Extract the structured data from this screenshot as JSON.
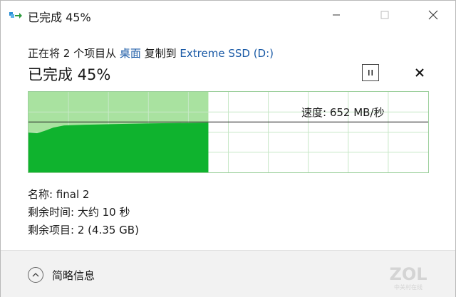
{
  "window": {
    "title": "已完成 45%"
  },
  "header": {
    "subtitle_prefix": "正在将 2 个项目从 ",
    "source": "桌面",
    "subtitle_middle": " 复制到 ",
    "destination": "Extreme SSD (D:)",
    "status": "已完成 45%"
  },
  "progress": {
    "percent": 45,
    "speed_label": "速度: 652 MB/秒"
  },
  "details": {
    "name_label": "名称:",
    "name_value": "final 2",
    "time_label": "剩余时间:",
    "time_value": "大约 10 秒",
    "items_label": "剩余项目:",
    "items_value": "2 (4.35 GB)"
  },
  "footer": {
    "collapse_label": "简略信息"
  },
  "watermark": {
    "text": "ZOL",
    "sub": "中关村在线"
  },
  "colors": {
    "fill_dark": "#0fb32e",
    "fill_light": "#a9e2a0",
    "grid": "#c7e8c7",
    "link": "#1a5aa6"
  }
}
